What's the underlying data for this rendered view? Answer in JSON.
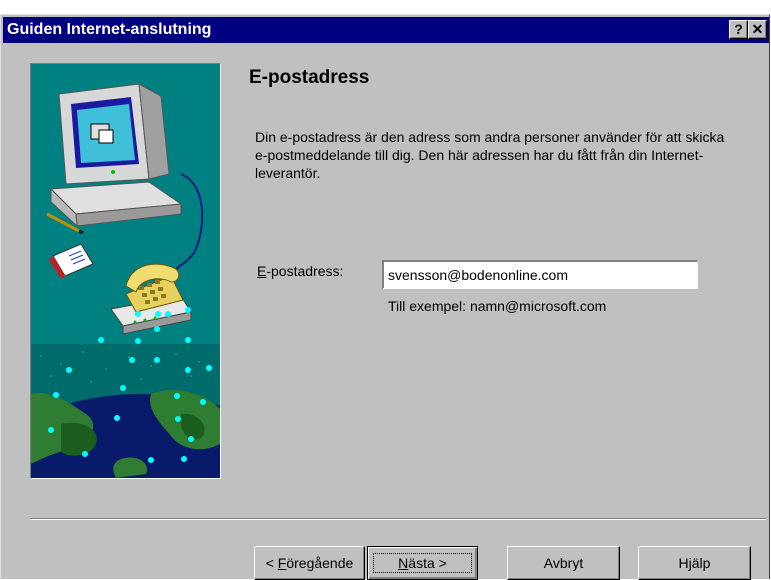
{
  "window": {
    "title": "Guiden Internet-anslutning",
    "help_button": "?",
    "close_button": "✕"
  },
  "main": {
    "heading": "E-postadress",
    "description": "Din e-postadress är den adress som andra personer använder för att skicka e-postmeddelande till dig. Den här adressen har du fått från din Internet-leverantör.",
    "email_label_accel": "E",
    "email_label_rest": "-postadress:",
    "email_value": "svensson@bodenonline.com",
    "example": "Till exempel: namn@microsoft.com"
  },
  "buttons": {
    "back_prefix": "< ",
    "back_accel": "F",
    "back_rest": "öregående",
    "next_accel": "N",
    "next_rest": "ästa >",
    "cancel": "Avbryt",
    "help": "Hjälp"
  },
  "colors": {
    "titlebar": "#000080",
    "dialog": "#c0c0c0",
    "art_background": "#008080"
  }
}
